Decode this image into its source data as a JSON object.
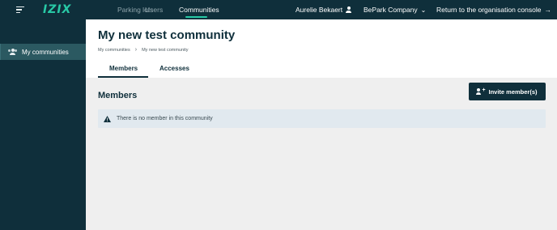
{
  "topbar": {
    "logo_text": "IZIX",
    "nav": [
      {
        "label": "Parking lots",
        "active": false
      },
      {
        "label": "Users",
        "active": false
      },
      {
        "label": "Communities",
        "active": true
      }
    ],
    "user_name": "Aurelie Bekaert",
    "company": "BePark Company",
    "return_link": "Return to the organisation console",
    "return_arrow": "→",
    "company_chevron": "⌄"
  },
  "sidebar": {
    "items": [
      {
        "label": "My communities",
        "icon": "people-icon",
        "active": true
      }
    ]
  },
  "main": {
    "title": "My new test community",
    "breadcrumb": [
      "My communities",
      "My new test community"
    ],
    "breadcrumb_separator": "›",
    "tabs": [
      {
        "label": "Members",
        "active": true
      },
      {
        "label": "Accesses",
        "active": false
      }
    ],
    "section_title": "Members",
    "invite_button": "Invite member(s)",
    "alert_text": "There is no member in this community"
  },
  "colors": {
    "dark": "#0f2f3b",
    "accent": "#28c9a6",
    "sidebar_active": "#2b5961",
    "alert_bg": "#e1e9ef"
  }
}
